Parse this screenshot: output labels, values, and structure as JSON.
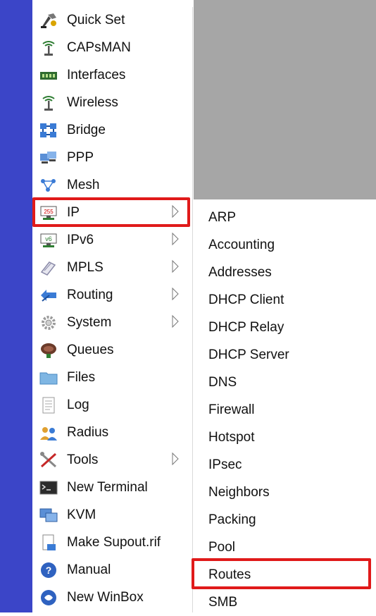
{
  "menu": {
    "items": [
      {
        "label": "Quick Set",
        "icon": "quick-set-icon"
      },
      {
        "label": "CAPsMAN",
        "icon": "antenna-icon"
      },
      {
        "label": "Interfaces",
        "icon": "interfaces-icon"
      },
      {
        "label": "Wireless",
        "icon": "wireless-icon"
      },
      {
        "label": "Bridge",
        "icon": "bridge-icon"
      },
      {
        "label": "PPP",
        "icon": "ppp-icon"
      },
      {
        "label": "Mesh",
        "icon": "mesh-icon"
      },
      {
        "label": "IP",
        "icon": "ip-icon",
        "has_submenu": true,
        "selected": true
      },
      {
        "label": "IPv6",
        "icon": "ipv6-icon",
        "has_submenu": true
      },
      {
        "label": "MPLS",
        "icon": "mpls-icon",
        "has_submenu": true
      },
      {
        "label": "Routing",
        "icon": "routing-icon",
        "has_submenu": true
      },
      {
        "label": "System",
        "icon": "gear-icon",
        "has_submenu": true
      },
      {
        "label": "Queues",
        "icon": "queues-icon"
      },
      {
        "label": "Files",
        "icon": "folder-icon"
      },
      {
        "label": "Log",
        "icon": "log-icon"
      },
      {
        "label": "Radius",
        "icon": "users-icon"
      },
      {
        "label": "Tools",
        "icon": "tools-icon",
        "has_submenu": true
      },
      {
        "label": "New Terminal",
        "icon": "terminal-icon"
      },
      {
        "label": "KVM",
        "icon": "kvm-icon"
      },
      {
        "label": "Make Supout.rif",
        "icon": "document-icon"
      },
      {
        "label": "Manual",
        "icon": "help-icon"
      },
      {
        "label": "New WinBox",
        "icon": "winbox-icon"
      }
    ]
  },
  "submenu": {
    "parent": "IP",
    "items": [
      "ARP",
      "Accounting",
      "Addresses",
      "DHCP Client",
      "DHCP Relay",
      "DHCP Server",
      "DNS",
      "Firewall",
      "Hotspot",
      "IPsec",
      "Neighbors",
      "Packing",
      "Pool",
      "Routes",
      "SMB"
    ],
    "highlighted": "Routes"
  },
  "colors": {
    "side_strip": "#3b45c8",
    "highlight_border": "#e01a1a",
    "workspace_gray": "#a6a6a6"
  }
}
